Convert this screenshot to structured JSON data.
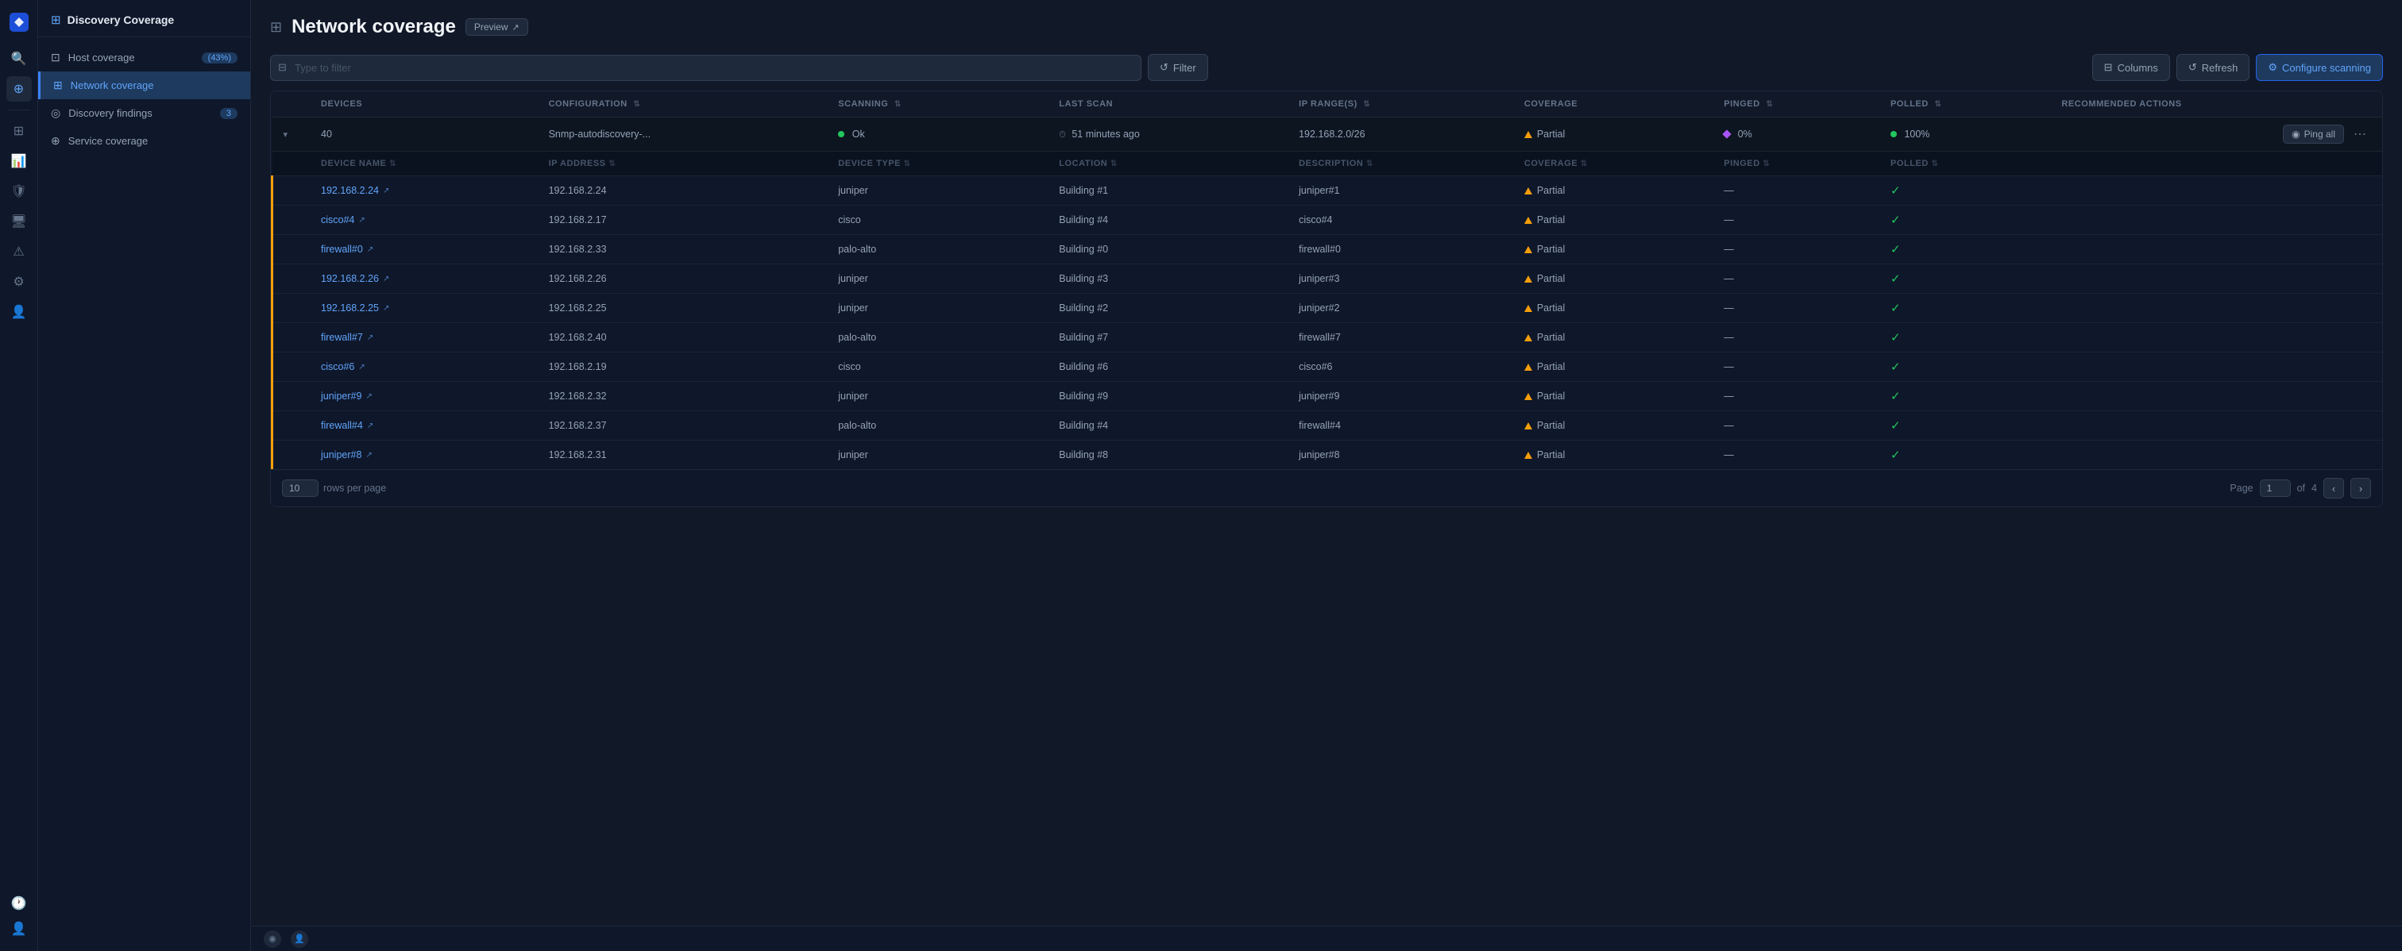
{
  "app": {
    "title": "Discovery & Coverage"
  },
  "sidebar": {
    "header_title": "Discovery Coverage",
    "items": [
      {
        "id": "host-coverage",
        "label": "Host coverage",
        "badge": "(43%)",
        "active": false,
        "icon": "⊡"
      },
      {
        "id": "network-coverage",
        "label": "Network coverage",
        "badge": null,
        "active": true,
        "icon": "⊞"
      },
      {
        "id": "discovery-findings",
        "label": "Discovery findings",
        "badge": "3",
        "active": false,
        "icon": "◎"
      },
      {
        "id": "service-coverage",
        "label": "Service coverage",
        "badge": null,
        "active": false,
        "icon": "⊕"
      }
    ]
  },
  "page": {
    "title": "Network coverage",
    "preview_label": "Preview",
    "columns_label": "Columns",
    "refresh_label": "Refresh",
    "configure_label": "Configure scanning",
    "filter_placeholder": "Type to filter",
    "filter_label": "Filter"
  },
  "table": {
    "group_columns": [
      "Devices",
      "Configuration",
      "Scanning",
      "Last scan",
      "IP range(s)",
      "Coverage",
      "Pinged",
      "Polled",
      "Recommended actions"
    ],
    "group_row": {
      "devices": "40",
      "configuration": "Snmp-autodiscovery-...",
      "scanning": "Ok",
      "last_scan": "51 minutes ago",
      "ip_range": "192.168.2.0/26",
      "coverage": "Partial",
      "pinged": "0%",
      "polled": "100%",
      "ping_all": "Ping all"
    },
    "sub_columns": [
      "Device name",
      "IP address",
      "Device type",
      "Location",
      "Description",
      "Coverage",
      "Pinged",
      "Polled"
    ],
    "rows": [
      {
        "name": "192.168.2.24",
        "ip": "192.168.2.24",
        "type": "juniper",
        "location": "Building #1",
        "description": "juniper#1",
        "coverage": "Partial",
        "pinged": "—",
        "polled": "✓"
      },
      {
        "name": "cisco#4",
        "ip": "192.168.2.17",
        "type": "cisco",
        "location": "Building #4",
        "description": "cisco#4",
        "coverage": "Partial",
        "pinged": "—",
        "polled": "✓"
      },
      {
        "name": "firewall#0",
        "ip": "192.168.2.33",
        "type": "palo-alto",
        "location": "Building #0",
        "description": "firewall#0",
        "coverage": "Partial",
        "pinged": "—",
        "polled": "✓"
      },
      {
        "name": "192.168.2.26",
        "ip": "192.168.2.26",
        "type": "juniper",
        "location": "Building #3",
        "description": "juniper#3",
        "coverage": "Partial",
        "pinged": "—",
        "polled": "✓"
      },
      {
        "name": "192.168.2.25",
        "ip": "192.168.2.25",
        "type": "juniper",
        "location": "Building #2",
        "description": "juniper#2",
        "coverage": "Partial",
        "pinged": "—",
        "polled": "✓"
      },
      {
        "name": "firewall#7",
        "ip": "192.168.2.40",
        "type": "palo-alto",
        "location": "Building #7",
        "description": "firewall#7",
        "coverage": "Partial",
        "pinged": "—",
        "polled": "✓"
      },
      {
        "name": "cisco#6",
        "ip": "192.168.2.19",
        "type": "cisco",
        "location": "Building #6",
        "description": "cisco#6",
        "coverage": "Partial",
        "pinged": "—",
        "polled": "✓"
      },
      {
        "name": "juniper#9",
        "ip": "192.168.2.32",
        "type": "juniper",
        "location": "Building #9",
        "description": "juniper#9",
        "coverage": "Partial",
        "pinged": "—",
        "polled": "✓"
      },
      {
        "name": "firewall#4",
        "ip": "192.168.2.37",
        "type": "palo-alto",
        "location": "Building #4",
        "description": "firewall#4",
        "coverage": "Partial",
        "pinged": "—",
        "polled": "✓"
      },
      {
        "name": "juniper#8",
        "ip": "192.168.2.31",
        "type": "juniper",
        "location": "Building #8",
        "description": "juniper#8",
        "coverage": "Partial",
        "pinged": "—",
        "polled": "✓"
      }
    ]
  },
  "pagination": {
    "rows_per_page": "10",
    "rows_per_page_label": "rows per page",
    "page_label": "Page",
    "current_page": "1",
    "total_pages": "4",
    "of_label": "of"
  }
}
